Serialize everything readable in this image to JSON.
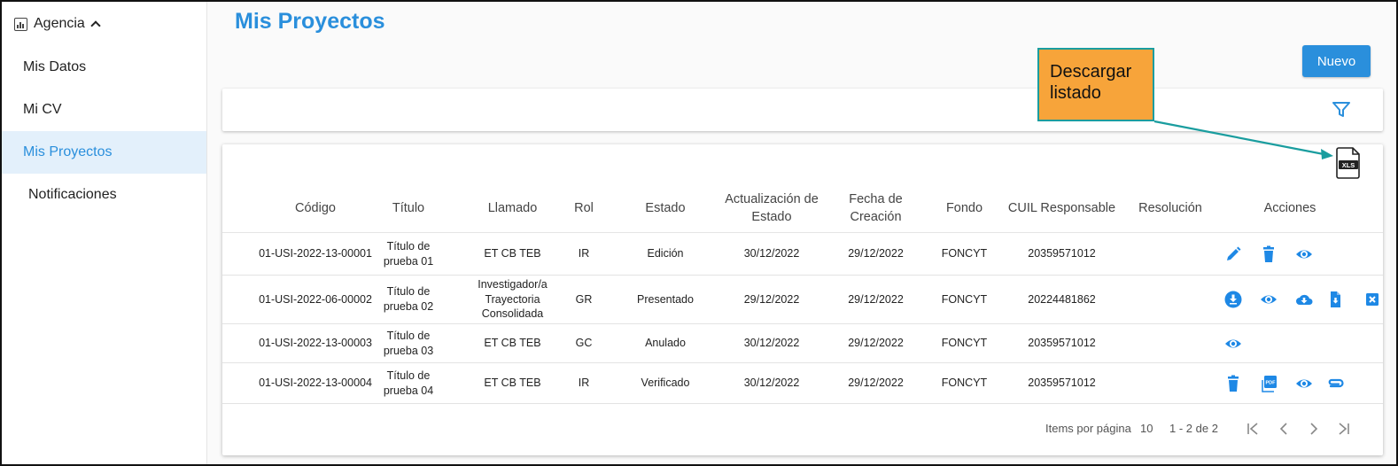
{
  "sidebar": {
    "section": "Agencia",
    "items": [
      {
        "label": "Mis Datos"
      },
      {
        "label": "Mi CV"
      },
      {
        "label": "Mis Proyectos"
      },
      {
        "label": "Notificaciones"
      }
    ]
  },
  "page": {
    "title": "Mis Proyectos",
    "new_button": "Nuevo"
  },
  "callout": {
    "line1": "Descargar",
    "line2": "listado"
  },
  "table": {
    "headers": [
      "Código",
      "Título",
      "Llamado",
      "Rol",
      "Estado",
      "Actualización de Estado",
      "Fecha de Creación",
      "Fondo",
      "CUIL Responsable",
      "Resolución",
      "Acciones"
    ],
    "rows": [
      {
        "codigo": "01-USI-2022-13-00001",
        "titulo": "Título de prueba 01",
        "llamado": "ET CB TEB",
        "rol": "IR",
        "estado": "Edición",
        "actualizacion": "30/12/2022",
        "creacion": "29/12/2022",
        "fondo": "FONCYT",
        "cuil": "20359571012",
        "resolucion": "",
        "actions": [
          "edit-icon",
          "delete-icon",
          "view-icon"
        ]
      },
      {
        "codigo": "01-USI-2022-06-00002",
        "titulo": "Título de prueba 02",
        "llamado": "Investigador/a Trayectoria Consolidada",
        "rol": "GR",
        "estado": "Presentado",
        "actualizacion": "29/12/2022",
        "creacion": "29/12/2022",
        "fondo": "FONCYT",
        "cuil": "20224481862",
        "resolucion": "",
        "actions": [
          "download-circle-icon",
          "view-icon",
          "cloud-download-icon",
          "file-download-icon",
          "close-box-icon"
        ]
      },
      {
        "codigo": "01-USI-2022-13-00003",
        "titulo": "Título de prueba 03",
        "llamado": "ET CB TEB",
        "rol": "GC",
        "estado": "Anulado",
        "actualizacion": "30/12/2022",
        "creacion": "29/12/2022",
        "fondo": "FONCYT",
        "cuil": "20359571012",
        "resolucion": "",
        "actions": [
          "view-icon"
        ]
      },
      {
        "codigo": "01-USI-2022-13-00004",
        "titulo": "Título de prueba 04",
        "llamado": "ET CB TEB",
        "rol": "IR",
        "estado": "Verificado",
        "actualizacion": "30/12/2022",
        "creacion": "29/12/2022",
        "fondo": "FONCYT",
        "cuil": "20359571012",
        "resolucion": "",
        "actions": [
          "delete-icon",
          "pdf-icon",
          "view-icon",
          "attach-icon"
        ]
      }
    ]
  },
  "pagination": {
    "items_label": "Items por página",
    "page_size": "10",
    "range": "1 - 2 de 2"
  },
  "icons": {
    "xls": "XLS",
    "pdf": "PDF"
  },
  "colors": {
    "accent": "#2a8fdc",
    "callout": "#f7a43a",
    "callout_border": "#1a9d9f"
  }
}
